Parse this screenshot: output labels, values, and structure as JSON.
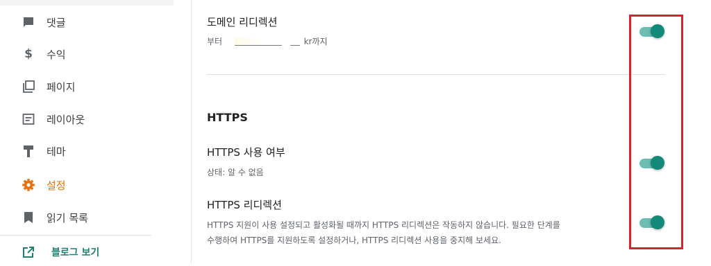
{
  "sidebar": {
    "items": [
      {
        "label": "댓글",
        "icon": "comment-icon"
      },
      {
        "label": "수익",
        "icon": "dollar-icon"
      },
      {
        "label": "페이지",
        "icon": "pages-icon"
      },
      {
        "label": "레이아웃",
        "icon": "layout-icon"
      },
      {
        "label": "테마",
        "icon": "paint-roller-icon"
      },
      {
        "label": "설정",
        "icon": "gear-icon",
        "active": true
      },
      {
        "label": "읽기 목록",
        "icon": "bookmark-icon"
      }
    ],
    "view_blog": {
      "label": "블로그 보기",
      "icon": "external-link-icon"
    }
  },
  "main": {
    "domain_redirect": {
      "title": "도메인 리디렉션",
      "desc_prefix": "부터",
      "desc_suffix": "kr까지",
      "enabled": true
    },
    "https_section_title": "HTTPS",
    "https_enabled": {
      "title": "HTTPS 사용 여부",
      "desc": "상태: 알 수 없음",
      "enabled": true
    },
    "https_redirect": {
      "title": "HTTPS 리디렉션",
      "desc_line1": "HTTPS 지원이 사용 설정되고 활성화될 때까지 HTTPS 리디렉션은 작동하지 않습니다. 필요한 단계를",
      "desc_line2": "수행하여 HTTPS를 지원하도록 설정하거나, HTTPS 리디렉션 사용을 중지해 보세요.",
      "enabled": true
    }
  },
  "colors": {
    "accent_active": "#e8710a",
    "toggle_thumb": "#13897a",
    "toggle_track": "#6dbdb2",
    "highlight": "#d5252b",
    "view_blog": "#1e7f72"
  }
}
